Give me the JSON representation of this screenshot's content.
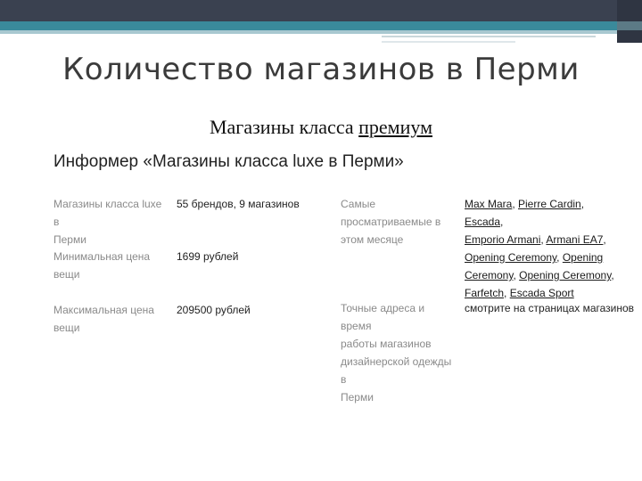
{
  "slide": {
    "title": "Количество магазинов в Перми",
    "subtitle_prefix": "Магазины класса ",
    "subtitle_underlined": "премиум"
  },
  "informer": {
    "heading": "Информер «Магазины класса luxe в Перми»",
    "rows": [
      {
        "label_line1": "Магазины класса luxe в",
        "label_line2": "Перми",
        "value": "55 брендов, 9 магазинов"
      },
      {
        "label_line1": "Минимальная цена",
        "label_line2": "вещи",
        "value": "1699 рублей"
      },
      {
        "label_line1": "Максимальная цена",
        "label_line2": "вещи",
        "value": "209500 рублей"
      }
    ],
    "right_rows": [
      {
        "label_lines": [
          "Самые",
          "просматриваемые в",
          "этом месяце"
        ]
      },
      {
        "label_lines": [
          "Точные адреса и время",
          "работы магазинов",
          "дизайнерской одежды в",
          "Перми"
        ],
        "value": "смотрите на страницах магазинов"
      }
    ],
    "brand_links": [
      "Max Mara",
      "Pierre Cardin",
      "Escada",
      "Emporio Armani",
      "Armani EA7",
      "Opening Ceremony",
      "Opening Ceremony",
      "Opening Ceremony",
      "Farfetch",
      "Escada Sport"
    ]
  }
}
